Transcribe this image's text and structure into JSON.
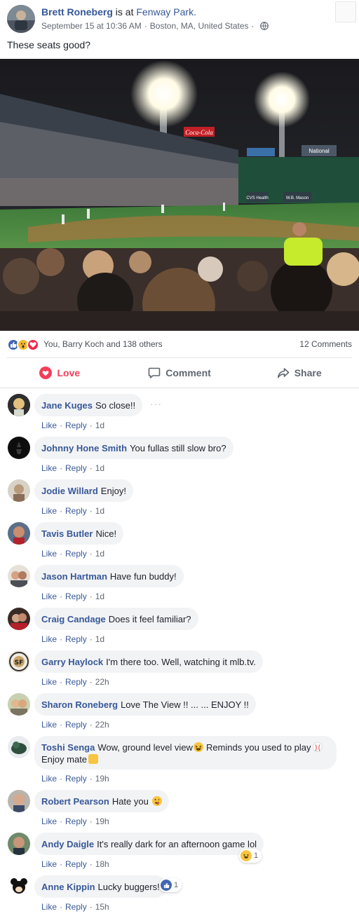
{
  "post": {
    "author": "Brett Roneberg",
    "action_prefix": "is at",
    "place": "Fenway Park.",
    "date": "September 15 at 10:36 AM",
    "separator": "·",
    "location": "Boston, MA, United States",
    "privacy_icon": "globe-icon",
    "text": "These seats good?",
    "photo_signs": [
      "Coca-Cola",
      "National",
      "CVS Health",
      "W.B. Mason"
    ]
  },
  "reactions": {
    "icons": [
      "like",
      "wow",
      "love"
    ],
    "names": "You, Barry Koch and 138 others",
    "comment_count": "12 Comments"
  },
  "actions": {
    "love": "Love",
    "comment": "Comment",
    "share": "Share"
  },
  "comment_actions": {
    "like": "Like",
    "reply": "Reply",
    "dot": "·"
  },
  "comments": [
    {
      "author": "Jane Kuges",
      "text": "So close!!",
      "time": "1d"
    },
    {
      "author": "Johnny Hone Smith",
      "text": "You fullas still slow bro?",
      "time": "1d"
    },
    {
      "author": "Jodie Willard",
      "text": "Enjoy!",
      "time": "1d"
    },
    {
      "author": "Tavis Butler",
      "text": "Nice!",
      "time": "1d"
    },
    {
      "author": "Jason Hartman",
      "text": "Have fun buddy!",
      "time": "1d"
    },
    {
      "author": "Craig Candage",
      "text": "Does it feel familiar?",
      "time": "1d"
    },
    {
      "author": "Garry Haylock",
      "text": "I'm there too. Well, watching it mlb.tv.",
      "time": "22h"
    },
    {
      "author": "Sharon Roneberg",
      "text": "Love The View !! ... ... ENJOY !!",
      "time": "22h"
    },
    {
      "author": "Toshi Senga",
      "text_1": "Wow, ground level view",
      "text_2": "Reminds you used to play",
      "text_3": "Enjoy mate",
      "time": "19h"
    },
    {
      "author": "Robert Pearson",
      "text": "Hate you",
      "time": "19h"
    },
    {
      "author": "Andy Daigle",
      "text": "It's really dark for an afternoon game lol",
      "time": "18h",
      "reaction_count": "1"
    },
    {
      "author": "Anne Kippin",
      "text": "Lucky buggers!",
      "time": "15h",
      "reaction_count": "1"
    }
  ],
  "colors": {
    "link_blue": "#385898",
    "love_red": "#f33e58",
    "like_blue": "#4267b2",
    "bubble_gray": "#f2f3f5"
  }
}
